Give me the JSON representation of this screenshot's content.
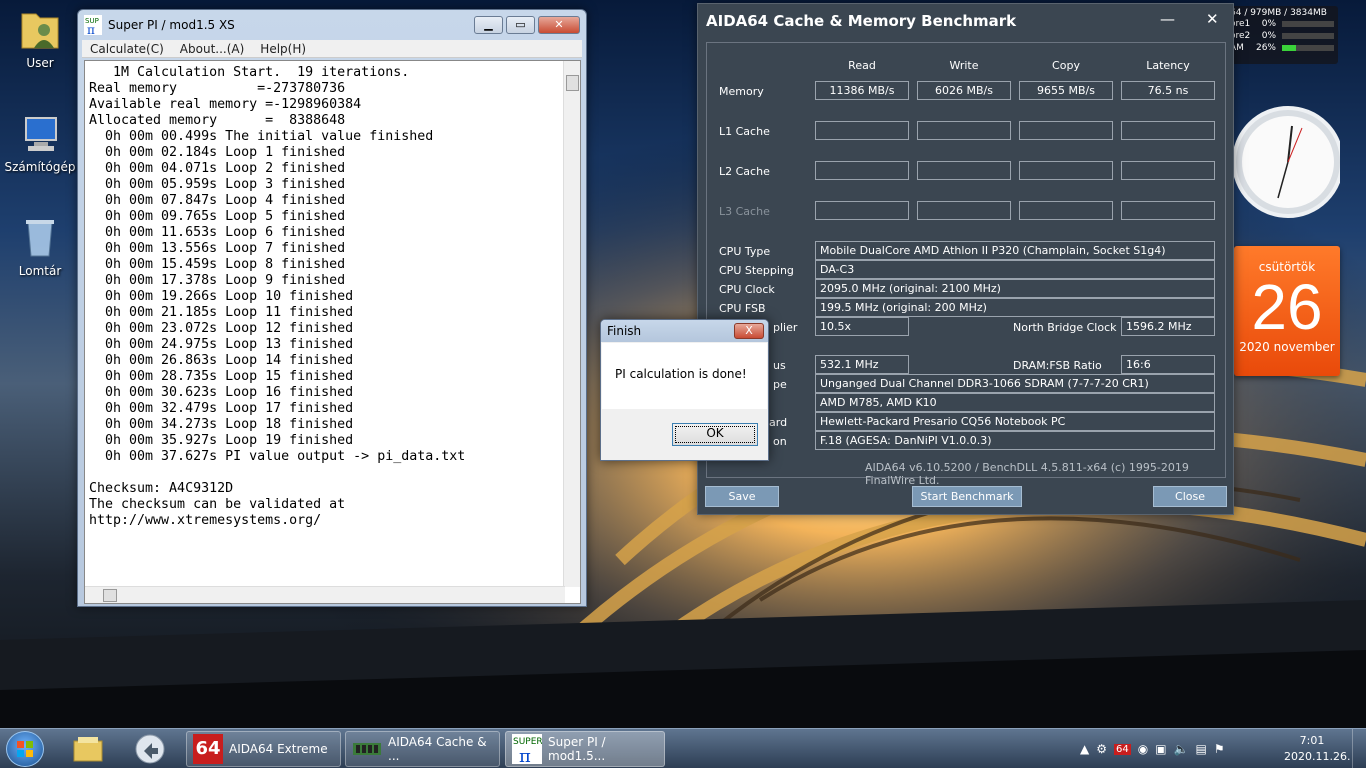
{
  "desktop": {
    "icons": [
      {
        "label": "User"
      },
      {
        "label": "Számítógép"
      },
      {
        "label": "Lomtár"
      }
    ]
  },
  "gadgets": {
    "meter_header": "64 / 979MB / 3834MB",
    "rows": [
      {
        "label": "ore1",
        "value": "0%",
        "fill": 0
      },
      {
        "label": "ore2",
        "value": "0%",
        "fill": 0
      },
      {
        "label": "AM",
        "value": "26%",
        "fill": 0.26
      }
    ],
    "calendar": {
      "dow": "csütörtök",
      "day": "26",
      "month": "2020 november"
    }
  },
  "superpi": {
    "title": "Super PI / mod1.5 XS",
    "menu": [
      "Calculate(C)",
      "About...(A)",
      "Help(H)"
    ],
    "lines": [
      "   1M Calculation Start.  19 iterations.",
      "Real memory          =-273780736",
      "Available real memory =-1298960384",
      "Allocated memory      =  8388648",
      "  0h 00m 00.499s The initial value finished",
      "  0h 00m 02.184s Loop 1 finished",
      "  0h 00m 04.071s Loop 2 finished",
      "  0h 00m 05.959s Loop 3 finished",
      "  0h 00m 07.847s Loop 4 finished",
      "  0h 00m 09.765s Loop 5 finished",
      "  0h 00m 11.653s Loop 6 finished",
      "  0h 00m 13.556s Loop 7 finished",
      "  0h 00m 15.459s Loop 8 finished",
      "  0h 00m 17.378s Loop 9 finished",
      "  0h 00m 19.266s Loop 10 finished",
      "  0h 00m 21.185s Loop 11 finished",
      "  0h 00m 23.072s Loop 12 finished",
      "  0h 00m 24.975s Loop 13 finished",
      "  0h 00m 26.863s Loop 14 finished",
      "  0h 00m 28.735s Loop 15 finished",
      "  0h 00m 30.623s Loop 16 finished",
      "  0h 00m 32.479s Loop 17 finished",
      "  0h 00m 34.273s Loop 18 finished",
      "  0h 00m 35.927s Loop 19 finished",
      "  0h 00m 37.627s PI value output -> pi_data.txt",
      "",
      "Checksum: A4C9312D",
      "The checksum can be validated at",
      "http://www.xtremesystems.org/"
    ]
  },
  "dialog": {
    "title": "Finish",
    "close": "X",
    "message": "PI calculation is done!",
    "ok": "OK"
  },
  "aida": {
    "title": "AIDA64 Cache & Memory Benchmark",
    "minimize": "—",
    "close": "✕",
    "headers": [
      "Read",
      "Write",
      "Copy",
      "Latency"
    ],
    "rows": [
      {
        "label": "Memory",
        "values": [
          "11386 MB/s",
          "6026 MB/s",
          "9655 MB/s",
          "76.5 ns"
        ]
      },
      {
        "label": "L1 Cache",
        "values": [
          "",
          "",
          "",
          ""
        ]
      },
      {
        "label": "L2 Cache",
        "values": [
          "",
          "",
          "",
          ""
        ]
      },
      {
        "label": "L3 Cache",
        "values": [
          "",
          "",
          "",
          ""
        ]
      }
    ],
    "info": {
      "cpu_type_label": "CPU Type",
      "cpu_type": "Mobile DualCore AMD Athlon II P320  (Champlain, Socket S1g4)",
      "cpu_stepping_label": "CPU Stepping",
      "cpu_stepping": "DA-C3",
      "cpu_clock_label": "CPU Clock",
      "cpu_clock": "2095.0 MHz  (original: 2100 MHz)",
      "cpu_fsb_label": "CPU FSB",
      "cpu_fsb": "199.5 MHz  (original: 200 MHz)",
      "multiplier_label": "plier",
      "multiplier": "10.5x",
      "nb_clock_label": "North Bridge Clock",
      "nb_clock": "1596.2 MHz",
      "bus_label": "us",
      "bus": "532.1 MHz",
      "ratio_label": "DRAM:FSB Ratio",
      "ratio": "16:6",
      "type_label": "pe",
      "type": "Unganged Dual Channel DDR3-1066 SDRAM  (7-7-7-20 CR1)",
      "chipset": "AMD M785, AMD K10",
      "board_label": "ard",
      "board": "Hewlett-Packard Presario CQ56 Notebook PC",
      "bios_label": "on",
      "bios": "F.18  (AGESA: DanNiPI V1.0.0.3)"
    },
    "footer": "AIDA64 v6.10.5200 / BenchDLL 4.5.811-x64  (c) 1995-2019 FinalWire Ltd.",
    "buttons": {
      "save": "Save",
      "start": "Start Benchmark",
      "close": "Close"
    }
  },
  "taskbar": {
    "tasks": [
      {
        "label": "AIDA64 Extreme"
      },
      {
        "label": "AIDA64 Cache & ..."
      },
      {
        "label": "Super PI / mod1.5..."
      }
    ],
    "time": "7:01",
    "date": "2020.11.26."
  }
}
